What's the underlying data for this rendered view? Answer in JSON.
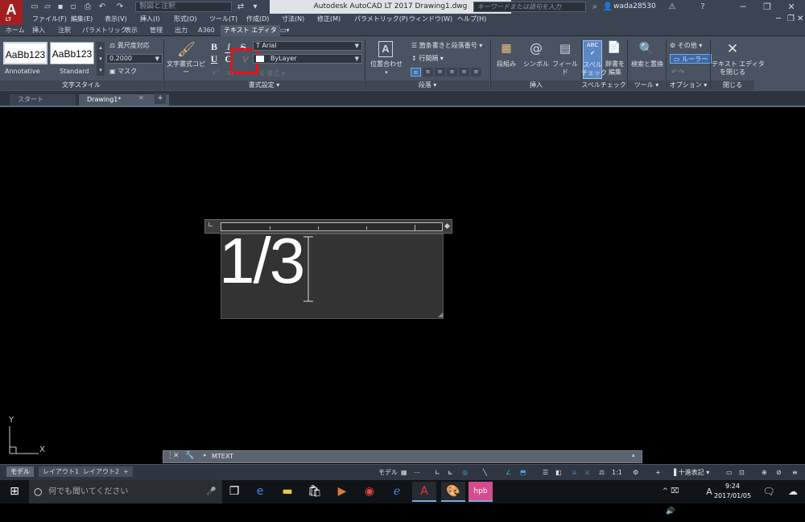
{
  "app": {
    "logo_letter": "A",
    "logo_sub": "LT",
    "workspace": "製図と注釈",
    "title": "Autodesk AutoCAD LT 2017    Drawing1.dwg",
    "search_placeholder": "キーワードまたは語句を入力",
    "user": "wada28530"
  },
  "menubar": [
    "ファイル(F)",
    "編集(E)",
    "表示(V)",
    "挿入(I)",
    "形式(O)",
    "ツール(T)",
    "作成(D)",
    "寸法(N)",
    "修正(M)",
    "パラメトリック(P)",
    "ウィンドウ(W)",
    "ヘルプ(H)"
  ],
  "ribbon_tabs": [
    "ホーム",
    "挿入",
    "注釈",
    "パラメトリック",
    "表示",
    "管理",
    "出力",
    "A360",
    "テキスト エディタ"
  ],
  "ribbon": {
    "text_style": {
      "tiles": [
        "AaBb123",
        "AaBb123"
      ],
      "tile_names": [
        "Annotative",
        "Standard"
      ],
      "annotative_toggle": "異尺度対応",
      "height_value": "0.2000",
      "mask": "マスク",
      "panel": "文字スタイル"
    },
    "formatting": {
      "match_btn": "文字書式コピー",
      "bold": "B",
      "italic": "I",
      "underline": "U",
      "overline": "O",
      "strike": "S",
      "font": "Arial",
      "color": "ByLayer",
      "extra": "書式",
      "panel": "書式設定"
    },
    "paragraph": {
      "justify_btn": "位置合わせ",
      "bullets": "箇条書きと段落番号",
      "line_spacing": "行間隔",
      "panel": "段落"
    },
    "insert": {
      "columns": "段組み",
      "symbol": "シンボル",
      "field": "フィールド",
      "panel": "挿入"
    },
    "spell": {
      "spell_check": "スペル\nチェック",
      "dictionaries": "辞書を\n編集",
      "panel": "スペルチェック"
    },
    "tools": {
      "find": "検索と置換",
      "panel": "ツール"
    },
    "options": {
      "more": "その他",
      "ruler": "ルーラー",
      "panel": "オプション"
    },
    "close": {
      "close_btn": "テキスト エディタ\nを閉じる",
      "panel": "閉じる"
    }
  },
  "doc_tabs": [
    "スタート",
    "Drawing1*"
  ],
  "canvas": {
    "mtext": "1/3",
    "ucs_x": "X",
    "ucs_y": "Y"
  },
  "command_line": {
    "text": "MTEXT"
  },
  "status": {
    "layout_tabs": [
      "モデル",
      "レイアウト1",
      "レイアウト2"
    ],
    "model_label": "モデル",
    "scale": "1:1",
    "units": "十進表記"
  },
  "taskbar": {
    "search_placeholder": "何でも聞いてください",
    "time": "9:24",
    "date": "2017/01/05",
    "ime": "A"
  }
}
